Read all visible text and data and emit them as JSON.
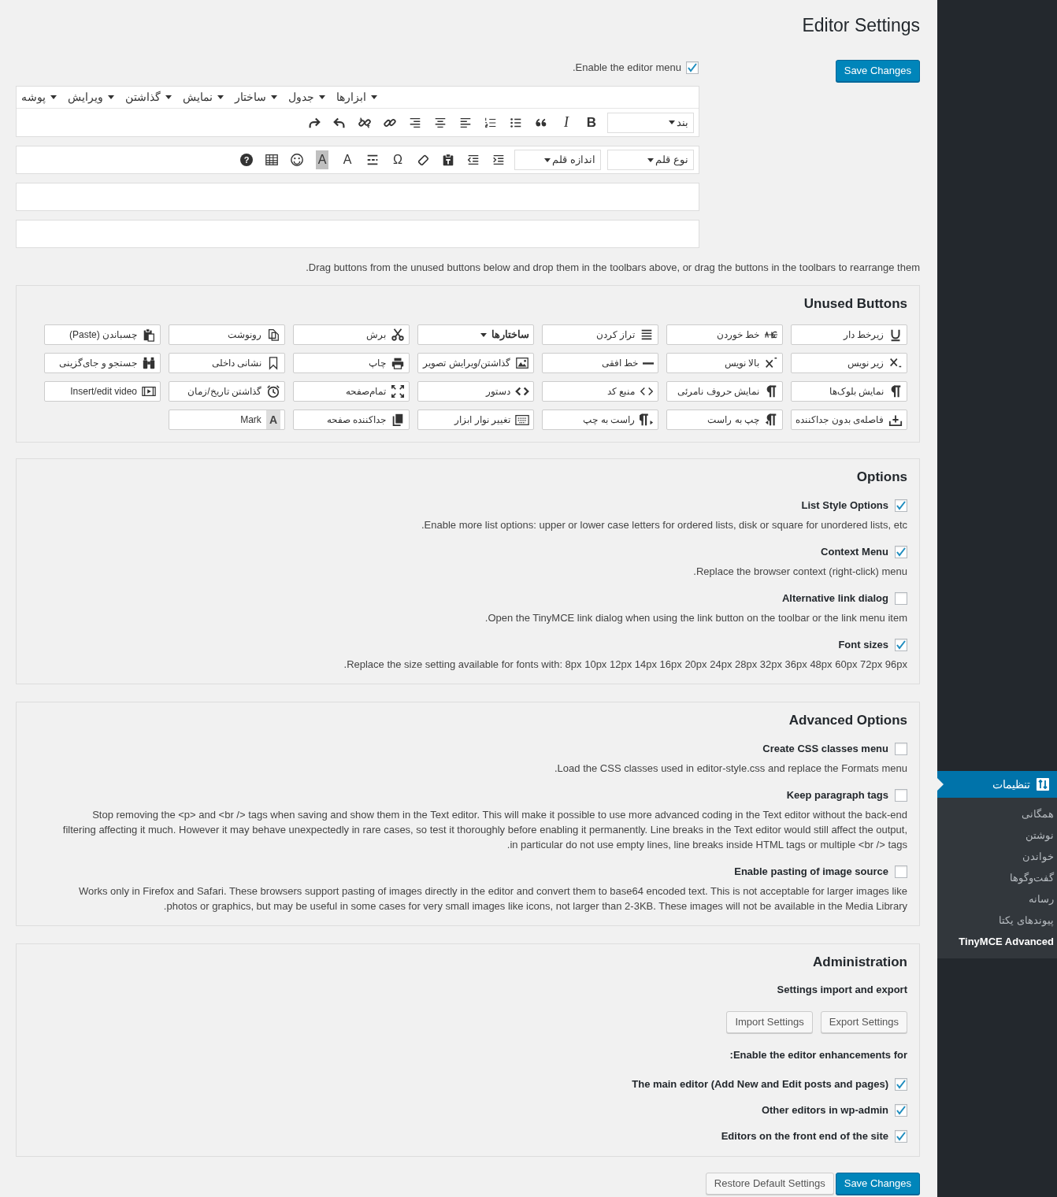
{
  "page_title": "Editor Settings",
  "top_save_button": "Save Changes",
  "editor_menu_option": {
    "label": "Enable the editor menu.",
    "checked": true
  },
  "menubar": [
    {
      "label": "ابزارها"
    },
    {
      "label": "جدول"
    },
    {
      "label": "ساختار"
    },
    {
      "label": "نمایش"
    },
    {
      "label": "گذاشتن"
    },
    {
      "label": "ویرایش"
    },
    {
      "label": "پوشه"
    }
  ],
  "toolbars": [
    [
      {
        "kind": "select",
        "label": "بند"
      },
      {
        "kind": "bold",
        "text": "B"
      },
      {
        "kind": "italic",
        "text": "I"
      },
      {
        "kind": "quote"
      },
      {
        "kind": "bullets"
      },
      {
        "kind": "numbers"
      },
      {
        "kind": "align-left"
      },
      {
        "kind": "align-center"
      },
      {
        "kind": "align-right"
      },
      {
        "kind": "link"
      },
      {
        "kind": "unlink"
      },
      {
        "kind": "undo"
      },
      {
        "kind": "redo"
      }
    ],
    [
      {
        "kind": "select",
        "label": "نوع قلم"
      },
      {
        "kind": "select",
        "label": "اندازه قلم"
      },
      {
        "kind": "indent"
      },
      {
        "kind": "outdent"
      },
      {
        "kind": "paste-text"
      },
      {
        "kind": "eraser"
      },
      {
        "kind": "letter",
        "text": "Ω"
      },
      {
        "kind": "lines"
      },
      {
        "kind": "letter",
        "text": "A"
      },
      {
        "kind": "highlight",
        "text": "A"
      },
      {
        "kind": "emoji"
      },
      {
        "kind": "table"
      },
      {
        "kind": "help",
        "text": "?"
      }
    ]
  ],
  "drag_hint": "Drag buttons from the unused buttons below and drop them in the toolbars above, or drag the buttons in the toolbars to rearrange them.",
  "unused_buttons": {
    "title": "Unused Buttons",
    "items": [
      {
        "kind": "underline",
        "label": "زیرخط دار"
      },
      {
        "kind": "strikethrough",
        "label": "خط خوردن"
      },
      {
        "kind": "justify",
        "label": "تراز کردن"
      },
      {
        "kind": "select",
        "label": "ساختارها"
      },
      {
        "kind": "cut",
        "label": "برش"
      },
      {
        "kind": "copy",
        "label": "رونوشت"
      },
      {
        "kind": "paste",
        "label": "چسباندن (Paste)"
      },
      {
        "kind": "subscript",
        "label": "زیر نویس"
      },
      {
        "kind": "superscript",
        "label": "بالا نویس"
      },
      {
        "kind": "hr",
        "label": "خط افقی"
      },
      {
        "kind": "image",
        "label": "گذاشتن/ویرایش تصویر"
      },
      {
        "kind": "print",
        "label": "چاپ"
      },
      {
        "kind": "bookmark",
        "label": "نشانی داخلی"
      },
      {
        "kind": "binoculars",
        "label": "جستجو و جای‌گزینی"
      },
      {
        "kind": "pilcrow",
        "label": "نمایش بلوک‌ها"
      },
      {
        "kind": "pilcrow",
        "label": "نمایش حروف نامرئی"
      },
      {
        "kind": "code",
        "label": "منبع کد"
      },
      {
        "kind": "code-bold",
        "label": "دستور"
      },
      {
        "kind": "fullscreen",
        "label": "تمام‌صفحه"
      },
      {
        "kind": "clock",
        "label": "گذاشتن تاریخ/زمان"
      },
      {
        "kind": "film",
        "label": "Insert/edit video"
      },
      {
        "kind": "nonbreaking",
        "label": "فاصله‌ی بدون جداکننده"
      },
      {
        "kind": "ltr",
        "label": "چپ به راست"
      },
      {
        "kind": "rtl",
        "label": "راست به چپ"
      },
      {
        "kind": "keyboard",
        "label": "تغییر نوار ابزار"
      },
      {
        "kind": "pagebreak",
        "label": "جداکننده صفحه"
      },
      {
        "kind": "glyph",
        "text": "A",
        "label": "Mark"
      }
    ]
  },
  "options": {
    "title": "Options",
    "items": [
      {
        "label": "List Style Options",
        "checked": true,
        "description": "Enable more list options: upper or lower case letters for ordered lists, disk or square for unordered lists, etc."
      },
      {
        "label": "Context Menu",
        "checked": true,
        "description": "Replace the browser context (right-click) menu."
      },
      {
        "label": "Alternative link dialog",
        "checked": false,
        "description": "Open the TinyMCE link dialog when using the link button on the toolbar or the link menu item."
      },
      {
        "label": "Font sizes",
        "checked": true,
        "description": "Replace the size setting available for fonts with: 8px 10px 12px 14px 16px 20px 24px 28px 32px 36px 48px 60px 72px 96px."
      }
    ]
  },
  "advanced_options": {
    "title": "Advanced Options",
    "items": [
      {
        "label": "Create CSS classes menu",
        "checked": false,
        "description": "Load the CSS classes used in editor-style.css and replace the Formats menu."
      },
      {
        "label": "Keep paragraph tags",
        "checked": false,
        "description": "Stop removing the <p> and <br /> tags when saving and show them in the Text editor. This will make it possible to use more advanced coding in the Text editor without the back-end filtering affecting it much. However it may behave unexpectedly in rare cases, so test it thoroughly before enabling it permanently. Line breaks in the Text editor would still affect the output, in particular do not use empty lines, line breaks inside HTML tags or multiple <br /> tags."
      },
      {
        "label": "Enable pasting of image source",
        "checked": false,
        "description": "Works only in Firefox and Safari. These browsers support pasting of images directly in the editor and convert them to base64 encoded text. This is not acceptable for larger images like photos or graphics, but may be useful in some cases for very small images like icons, not larger than 2-3KB. These images will not be available in the Media Library."
      }
    ]
  },
  "administration": {
    "title": "Administration",
    "import_export_heading": "Settings import and export",
    "buttons": [
      "Export Settings",
      "Import Settings"
    ],
    "enhancements_heading": "Enable the editor enhancements for:",
    "items": [
      {
        "label": "The main editor (Add New and Edit posts and pages)",
        "checked": true
      },
      {
        "label": "Other editors in wp-admin",
        "checked": true
      },
      {
        "label": "Editors on the front end of the site",
        "checked": true
      }
    ]
  },
  "bottom_buttons": [
    {
      "kind": "primary",
      "label": "Save Changes"
    },
    {
      "kind": "secondary",
      "label": "Restore Default Settings"
    }
  ],
  "sidebar": {
    "active_menu": "تنظیمات",
    "items": [
      {
        "label": "همگانی",
        "selected": false
      },
      {
        "label": "نوشتن",
        "selected": false
      },
      {
        "label": "خواندن",
        "selected": false
      },
      {
        "label": "گفت‌وگوها",
        "selected": false
      },
      {
        "label": "رسانه",
        "selected": false
      },
      {
        "label": "پیوندهای یکتا",
        "selected": false
      },
      {
        "label": "TinyMCE Advanced",
        "selected": true
      }
    ]
  }
}
